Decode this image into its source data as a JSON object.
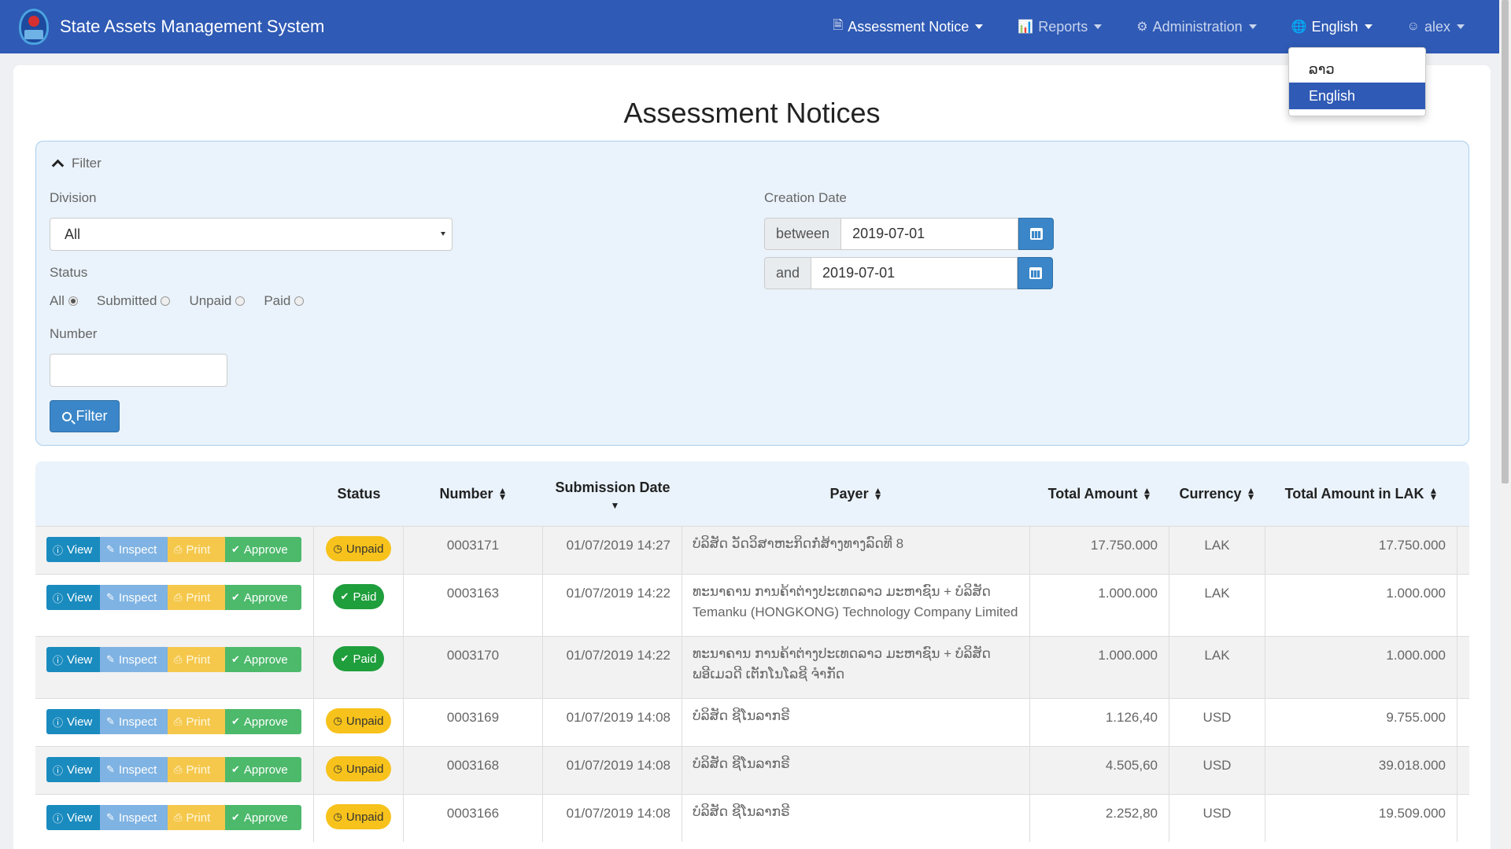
{
  "app": {
    "title": "State Assets Management System"
  },
  "nav": {
    "assessment": "Assessment Notice",
    "reports": "Reports",
    "administration": "Administration",
    "language": "English",
    "user": "alex"
  },
  "lang_menu": {
    "options": [
      "ລາວ",
      "English"
    ]
  },
  "page": {
    "title": "Assessment Notices"
  },
  "filter": {
    "toggle_label": "Filter",
    "division_label": "Division",
    "division_value": "All",
    "status_label": "Status",
    "status_options": [
      "All",
      "Submitted",
      "Unpaid",
      "Paid"
    ],
    "status_selected": "All",
    "number_label": "Number",
    "number_value": "",
    "filter_button": "Filter",
    "creation_date_label": "Creation Date",
    "between_label": "between",
    "from_date": "2019-07-01",
    "and_label": "and",
    "to_date": "2019-07-01"
  },
  "table": {
    "headers": {
      "status": "Status",
      "number": "Number",
      "submission_date": "Submission Date",
      "payer": "Payer",
      "total_amount": "Total Amount",
      "currency": "Currency",
      "total_lak": "Total Amount in LAK"
    },
    "actions": {
      "view": "View",
      "inspect": "Inspect",
      "print": "Print",
      "approve": "Approve"
    },
    "rows": [
      {
        "status": "Unpaid",
        "number": "0003171",
        "date": "01/07/2019 14:27",
        "payer": "ບໍລິສັດ ວັດວິສາຫະກິດກໍ່ສ້າງທາງລົດທີ 8",
        "payer2": "",
        "amount": "17.750.000",
        "currency": "LAK",
        "lak": "17.750.000"
      },
      {
        "status": "Paid",
        "number": "0003163",
        "date": "01/07/2019 14:22",
        "payer": "ທະນາຄານ ການຄ້າຕ່າງປະເທດລາວ ມະຫາຊົນ + ບໍລິສັດ",
        "payer2": "Temanku (HONGKONG) Technology Company Limited",
        "amount": "1.000.000",
        "currency": "LAK",
        "lak": "1.000.000"
      },
      {
        "status": "Paid",
        "number": "0003170",
        "date": "01/07/2019 14:22",
        "payer": "ທະນາຄານ ການຄ້າຕ່າງປະເທດລາວ ມະຫາຊົນ + ບໍລິສັດ",
        "payer2": "ພອີເມວດີ ເຕັກໂນໂລຊີ ຈຳກັດ",
        "amount": "1.000.000",
        "currency": "LAK",
        "lak": "1.000.000"
      },
      {
        "status": "Unpaid",
        "number": "0003169",
        "date": "01/07/2019 14:08",
        "payer": "ບໍລິສັດ ຊີໂນລາກຣີ",
        "payer2": "",
        "amount": "1.126,40",
        "currency": "USD",
        "lak": "9.755.000"
      },
      {
        "status": "Unpaid",
        "number": "0003168",
        "date": "01/07/2019 14:08",
        "payer": "ບໍລິສັດ ຊີໂນລາກຣີ",
        "payer2": "",
        "amount": "4.505,60",
        "currency": "USD",
        "lak": "39.018.000"
      },
      {
        "status": "Unpaid",
        "number": "0003166",
        "date": "01/07/2019 14:08",
        "payer": "ບໍລິສັດ ຊີໂນລາກຣີ",
        "payer2": "",
        "amount": "2.252,80",
        "currency": "USD",
        "lak": "19.509.000"
      }
    ]
  },
  "colors": {
    "navbar": "#2f5ab5",
    "primary": "#3a86c8",
    "unpaid": "#f7c21b",
    "paid": "#1f9e3c"
  }
}
